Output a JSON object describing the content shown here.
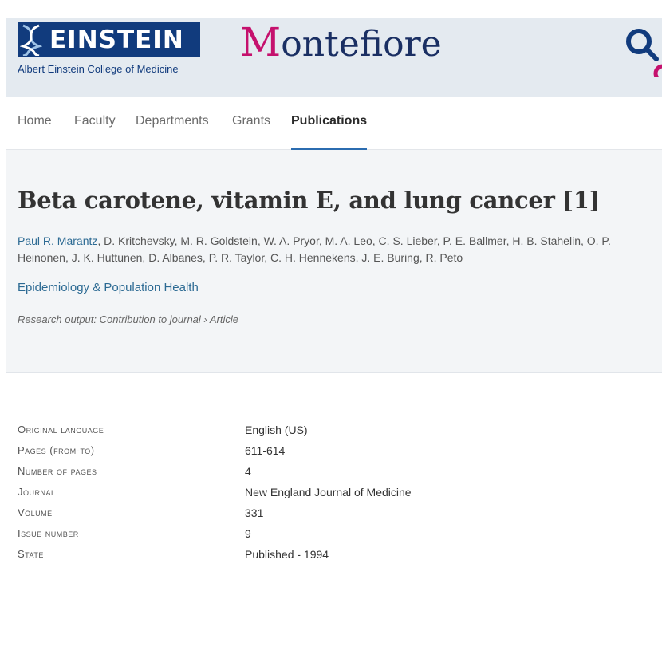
{
  "header": {
    "logo_word": "EINSTEIN",
    "logo_subtitle": "Albert Einstein College of Medicine",
    "partner_first": "M",
    "partner_rest": "ontefiore",
    "logo_color": "#113b7d",
    "partner_accent": "#c5116d"
  },
  "nav": {
    "items": [
      {
        "label": "Home"
      },
      {
        "label": "Faculty"
      },
      {
        "label": "Departments"
      },
      {
        "label": "Grants"
      },
      {
        "label": "Publications"
      }
    ],
    "active": "Publications"
  },
  "article": {
    "title": "Beta carotene, vitamin E, and lung cancer [1]",
    "first_author": "Paul R. Marantz",
    "other_authors": ", D. Kritchevsky, M. R. Goldstein, W. A. Pryor, M. A. Leo, C. S. Lieber, P. E. Ballmer, H. B. Stahelin, O. P. Heinonen, J. K. Huttunen, D. Albanes, P. R. Taylor, C. H. Hennekens, J. E. Buring, R. Peto",
    "organisation": "Epidemiology & Population Health",
    "output_type": "Research output: Contribution to journal › Article"
  },
  "details": [
    {
      "label": "Original language",
      "value": "English (US)"
    },
    {
      "label": "Pages (from-to)",
      "value": "611-614"
    },
    {
      "label": "Number of pages",
      "value": "4"
    },
    {
      "label": "Journal",
      "value": "New England Journal of Medicine"
    },
    {
      "label": "Volume",
      "value": "331"
    },
    {
      "label": "Issue number",
      "value": "9"
    },
    {
      "label": "State",
      "value": "Published - 1994"
    }
  ]
}
